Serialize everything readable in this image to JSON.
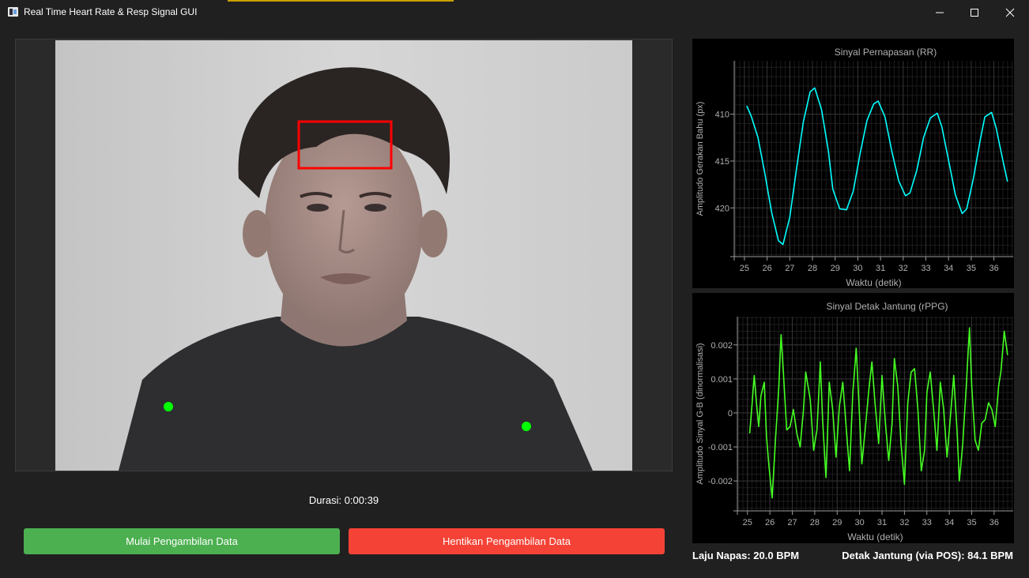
{
  "window": {
    "title": "Real Time Heart Rate & Resp Signal GUI",
    "accent_color": "#c8a000"
  },
  "controls": {
    "duration_text": "Durasi: 0:00:39",
    "start_label": "Mulai Pengambilan Data",
    "stop_label": "Hentikan Pengambilan Data",
    "start_color": "#4caf50",
    "stop_color": "#f44336"
  },
  "status": {
    "respiration_text": "Laju Napas: 20.0 BPM",
    "heart_rate_text": "Detak Jantung (via POS): 84.1 BPM"
  },
  "video": {
    "roi_color": "#ff0000",
    "shoulder_marker_color": "#00ff00"
  },
  "chart_data": [
    {
      "type": "line",
      "title": "Sinyal Pernapasan (RR)",
      "xlabel": "Waktu (detik)",
      "ylabel": "Amplitudo Gerakan Bahu (px)",
      "y_inverted": true,
      "x_ticks": [
        "25",
        "26",
        "27",
        "28",
        "29",
        "30",
        "31",
        "32",
        "33",
        "34",
        "35",
        "36"
      ],
      "y_ticks": [
        "410",
        "415",
        "420"
      ],
      "xlim": [
        24.55,
        36.85
      ],
      "ylim": [
        404.3,
        425.2
      ],
      "grid": true,
      "color": "#00ffff",
      "x": [
        25.1,
        25.3,
        25.6,
        25.9,
        26.2,
        26.5,
        26.7,
        27.0,
        27.3,
        27.6,
        27.9,
        28.1,
        28.4,
        28.7,
        28.9,
        29.2,
        29.5,
        29.8,
        30.1,
        30.4,
        30.7,
        30.9,
        31.2,
        31.5,
        31.8,
        32.1,
        32.3,
        32.6,
        32.9,
        33.2,
        33.5,
        33.7,
        34.0,
        34.3,
        34.6,
        34.8,
        35.1,
        35.4,
        35.6,
        35.9,
        36.1,
        36.4,
        36.6
      ],
      "y": [
        409.1,
        410.2,
        412.5,
        416.3,
        420.5,
        423.5,
        423.9,
        421.0,
        415.8,
        410.8,
        407.6,
        407.2,
        409.5,
        413.9,
        418.0,
        420.1,
        420.2,
        418.2,
        414.2,
        410.7,
        408.9,
        408.6,
        410.3,
        414.0,
        417.1,
        418.7,
        418.4,
        416.0,
        412.5,
        410.4,
        409.9,
        411.3,
        414.9,
        418.6,
        420.6,
        420.1,
        416.8,
        412.7,
        410.3,
        409.8,
        411.5,
        415.0,
        417.2
      ]
    },
    {
      "type": "line",
      "title": "Sinyal Detak Jantung (rPPG)",
      "xlabel": "Waktu (detik)",
      "ylabel": "Amplitudo Sinyal G-B (dinormalisasi)",
      "x_ticks": [
        "25",
        "26",
        "27",
        "28",
        "29",
        "30",
        "31",
        "32",
        "33",
        "34",
        "35",
        "36"
      ],
      "y_ticks": [
        "0.002",
        "0.001",
        "0",
        "-0.001",
        "-0.002"
      ],
      "xlim": [
        24.55,
        36.85
      ],
      "ylim": [
        -0.00288,
        0.00283
      ],
      "grid": true,
      "color": "#44ff22",
      "x": [
        25.1,
        25.2,
        25.3,
        25.4,
        25.5,
        25.6,
        25.75,
        25.85,
        25.95,
        26.1,
        26.25,
        26.4,
        26.5,
        26.6,
        26.75,
        26.9,
        27.05,
        27.2,
        27.35,
        27.5,
        27.6,
        27.8,
        27.95,
        28.1,
        28.25,
        28.35,
        28.5,
        28.65,
        28.8,
        28.95,
        29.1,
        29.25,
        29.4,
        29.55,
        29.7,
        29.85,
        30.0,
        30.1,
        30.25,
        30.4,
        30.55,
        30.7,
        30.85,
        31.0,
        31.15,
        31.3,
        31.45,
        31.55,
        31.7,
        31.85,
        32.0,
        32.15,
        32.3,
        32.45,
        32.6,
        32.75,
        32.9,
        33.0,
        33.15,
        33.3,
        33.45,
        33.6,
        33.75,
        33.9,
        34.05,
        34.2,
        34.35,
        34.45,
        34.6,
        34.75,
        34.9,
        35.0,
        35.15,
        35.3,
        35.45,
        35.6,
        35.75,
        35.9,
        36.05,
        36.2,
        36.3,
        36.45,
        36.6
      ],
      "y": [
        -0.0006,
        0.0002,
        0.0011,
        0.0003,
        -0.0004,
        0.0005,
        0.0009,
        -0.0007,
        -0.0015,
        -0.0025,
        -0.0008,
        0.0008,
        0.0023,
        0.0012,
        -0.0005,
        -0.0004,
        0.0001,
        -0.0006,
        -0.001,
        0.0001,
        0.0012,
        0.0004,
        -0.0011,
        -0.0005,
        0.0015,
        -0.0002,
        -0.0019,
        0.0009,
        0.0001,
        -0.0013,
        0.0002,
        0.0009,
        -0.0004,
        -0.0017,
        0.0006,
        0.0019,
        -0.0001,
        -0.0015,
        -0.0005,
        0.0006,
        0.0015,
        0.0002,
        -0.0009,
        0.0011,
        -0.0003,
        -0.0014,
        -0.0003,
        0.0016,
        0.0008,
        -0.0009,
        -0.0021,
        0.0003,
        0.0012,
        0.0013,
        0.0001,
        -0.0017,
        -0.0011,
        0.0006,
        0.0012,
        0.0001,
        -0.0011,
        0.0009,
        0.0001,
        -0.0013,
        -0.0001,
        0.0011,
        -0.0006,
        -0.002,
        -0.0009,
        0.0007,
        0.0025,
        0.0008,
        -0.0008,
        -0.0011,
        -0.0003,
        -0.0002,
        0.0003,
        0.0001,
        -0.0004,
        0.0008,
        0.0012,
        0.0024,
        0.0017
      ]
    }
  ]
}
